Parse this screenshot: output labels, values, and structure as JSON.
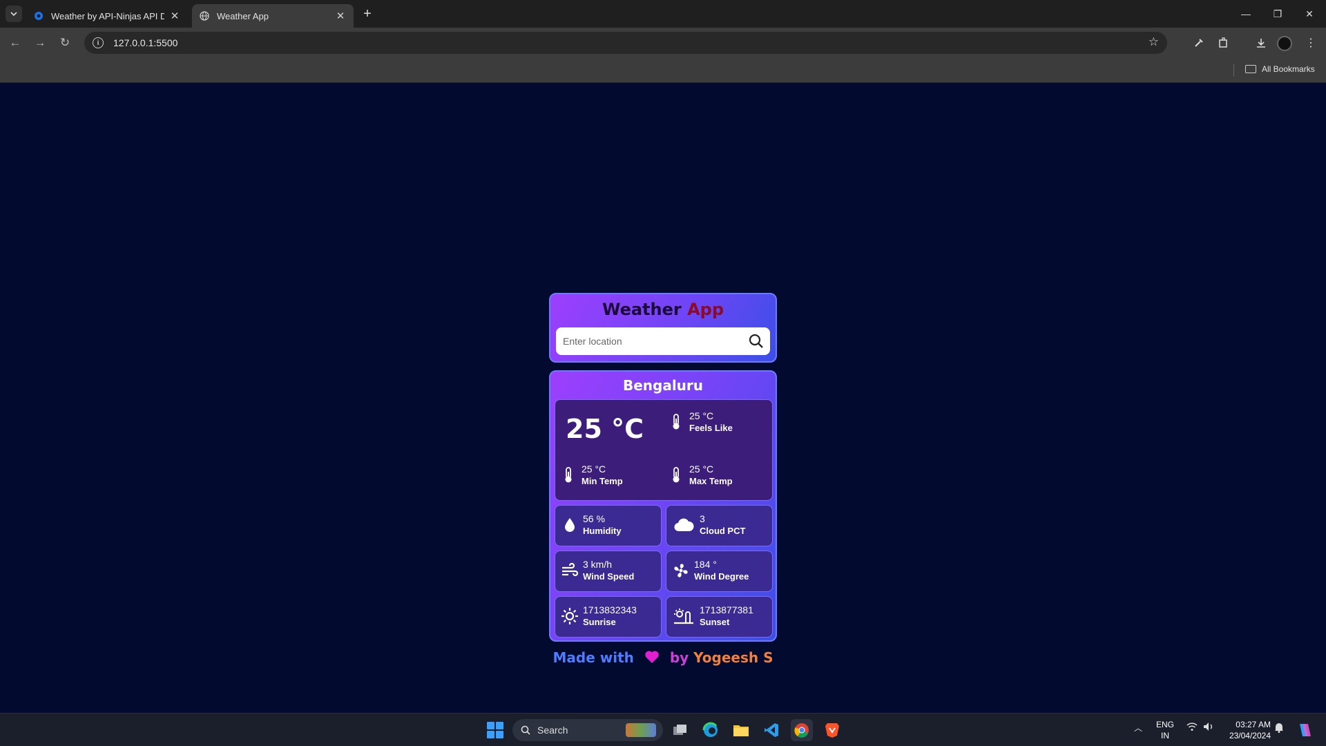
{
  "browser": {
    "tabs": [
      {
        "title": "Weather by API-Ninjas API Do"
      },
      {
        "title": "Weather App"
      }
    ],
    "url": "127.0.0.1:5500",
    "bookmarks_label": "All Bookmarks"
  },
  "app": {
    "title_part1": "Weather",
    "title_part2": "App",
    "search_placeholder": "Enter location",
    "city": "Bengaluru",
    "temp": "25 °C",
    "feels_like": {
      "value": "25 °C",
      "label": "Feels Like"
    },
    "min_temp": {
      "value": "25 °C",
      "label": "Min Temp"
    },
    "max_temp": {
      "value": "25 °C",
      "label": "Max Temp"
    },
    "humidity": {
      "value": "56 %",
      "label": "Humidity"
    },
    "cloud_pct": {
      "value": "3",
      "label": "Cloud PCT"
    },
    "wind_speed": {
      "value": "3 km/h",
      "label": "Wind Speed"
    },
    "wind_degree": {
      "value": "184 °",
      "label": "Wind Degree"
    },
    "sunrise": {
      "value": "1713832343",
      "label": "Sunrise"
    },
    "sunset": {
      "value": "1713877381",
      "label": "Sunset"
    },
    "footer": {
      "part1": "Made with",
      "part2": "by",
      "part3": "Yogeesh S"
    }
  },
  "taskbar": {
    "search_label": "Search",
    "lang_line1": "ENG",
    "lang_line2": "IN",
    "time": "03:27 AM",
    "date": "23/04/2024"
  },
  "colors": {
    "page_bg": "#020a30",
    "card_gradient_start": "#9d3ffd",
    "card_gradient_end": "#3b4fe8",
    "title_dark": "#1b0b3a",
    "title_red": "#8b0a28",
    "heart": "#e11fd0"
  }
}
